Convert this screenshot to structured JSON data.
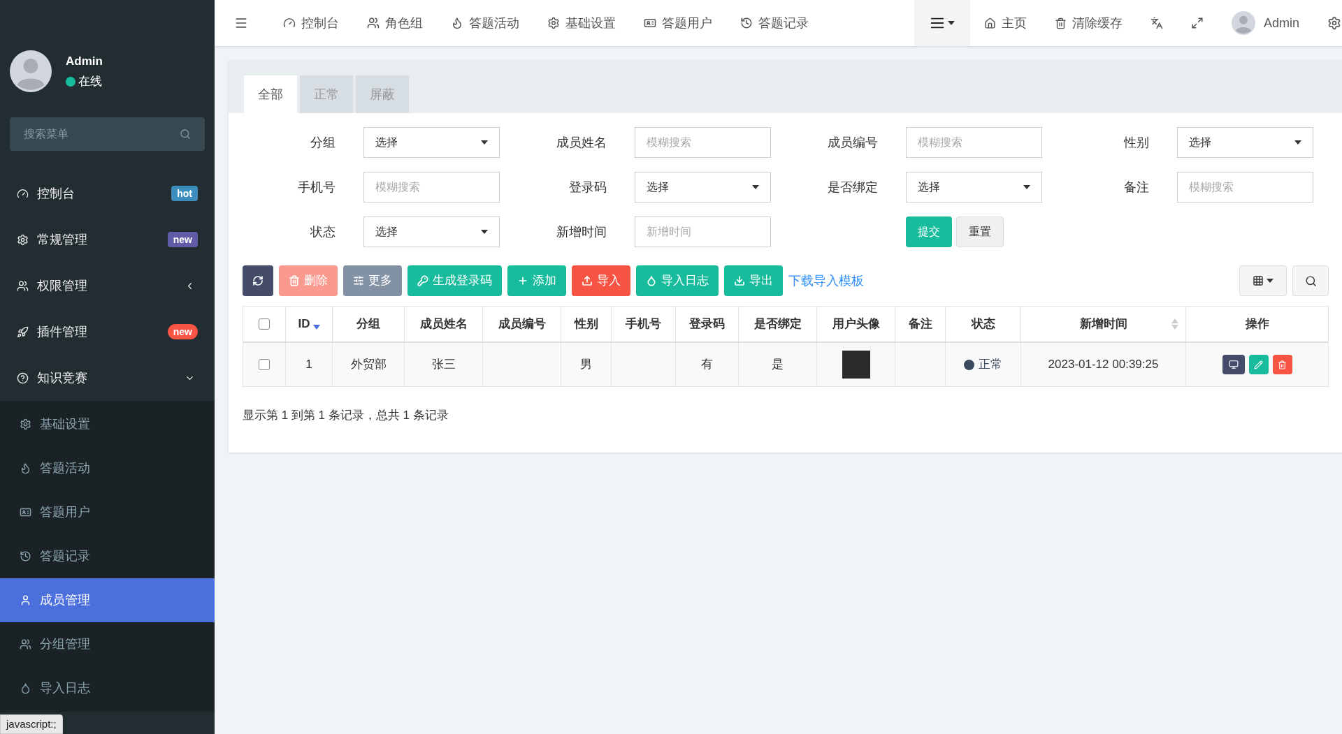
{
  "sidebar": {
    "user": {
      "name": "Admin",
      "status": "在线"
    },
    "search": {
      "placeholder": "搜索菜单"
    },
    "items": [
      {
        "label": "控制台",
        "badge": {
          "text": "hot",
          "color": "#3c8dbc"
        },
        "selected": false
      },
      {
        "label": "常规管理",
        "badge": {
          "text": "new",
          "color": "#605ca8"
        },
        "selected": false
      },
      {
        "label": "权限管理",
        "expanded": false,
        "selected": false
      },
      {
        "label": "插件管理",
        "badge": {
          "text": "new",
          "color": "#f75444"
        },
        "selected": false
      },
      {
        "label": "知识竞赛",
        "expanded": true,
        "selected": false,
        "children": [
          {
            "label": "基础设置",
            "selected": false
          },
          {
            "label": "答题活动",
            "selected": false
          },
          {
            "label": "答题用户",
            "selected": false
          },
          {
            "label": "答题记录",
            "selected": false
          },
          {
            "label": "成员管理",
            "selected": true
          },
          {
            "label": "分组管理",
            "selected": false
          },
          {
            "label": "导入日志",
            "selected": false
          }
        ]
      }
    ]
  },
  "status_tip": "javascript:;",
  "topbar": {
    "nav": [
      "控制台",
      "角色组",
      "答题活动",
      "基础设置",
      "答题用户",
      "答题记录"
    ],
    "home": "主页",
    "clear_cache": "清除缓存",
    "user": "Admin"
  },
  "tabs": [
    {
      "label": "全部",
      "selected": true
    },
    {
      "label": "正常",
      "selected": false
    },
    {
      "label": "屏蔽",
      "selected": false
    }
  ],
  "filters": [
    {
      "label": "分组",
      "kind": "select",
      "value": "选择"
    },
    {
      "label": "成员姓名",
      "kind": "text",
      "placeholder": "模糊搜索"
    },
    {
      "label": "成员编号",
      "kind": "text",
      "placeholder": "模糊搜索"
    },
    {
      "label": "性别",
      "kind": "select",
      "value": "选择"
    },
    {
      "label": "手机号",
      "kind": "text",
      "placeholder": "模糊搜索"
    },
    {
      "label": "登录码",
      "kind": "select",
      "value": "选择"
    },
    {
      "label": "是否绑定",
      "kind": "select",
      "value": "选择"
    },
    {
      "label": "备注",
      "kind": "text",
      "placeholder": "模糊搜索"
    },
    {
      "label": "状态",
      "kind": "select",
      "value": "选择"
    },
    {
      "label": "新增时间",
      "kind": "text",
      "placeholder": "新增时间"
    }
  ],
  "filter_buttons": [
    "提交",
    "重置"
  ],
  "toolbar": [
    {
      "kind": "refresh",
      "color": "#444c69"
    },
    {
      "kind": "delete",
      "label": "删除",
      "color": "#fa9a8f"
    },
    {
      "kind": "more",
      "label": "更多",
      "color": "#8391a5"
    },
    {
      "kind": "key",
      "label": "生成登录码",
      "color": "#18bc9c"
    },
    {
      "kind": "add",
      "label": "添加",
      "color": "#18bc9c"
    },
    {
      "kind": "upload",
      "label": "导入",
      "color": "#f75444"
    },
    {
      "kind": "drop",
      "label": "导入日志",
      "color": "#18bc9c"
    },
    {
      "kind": "download",
      "label": "导出",
      "color": "#18bc9c"
    }
  ],
  "template_link": "下载导入模板",
  "table": {
    "columns": [
      {
        "label": "ID",
        "sortable": true,
        "sorted_desc": true
      },
      {
        "label": "分组"
      },
      {
        "label": "成员姓名"
      },
      {
        "label": "成员编号"
      },
      {
        "label": "性别"
      },
      {
        "label": "手机号"
      },
      {
        "label": "登录码"
      },
      {
        "label": "是否绑定"
      },
      {
        "label": "用户头像"
      },
      {
        "label": "备注"
      },
      {
        "label": "状态"
      },
      {
        "label": "新增时间",
        "sortable": true,
        "sorted_desc": false
      },
      {
        "label": "操作"
      }
    ],
    "header_checked": false,
    "rows": [
      {
        "checked": false,
        "id": "1",
        "group": "外贸部",
        "name": "张三",
        "number": "",
        "gender": "男",
        "phone": "",
        "login_code": "有",
        "bound": "是",
        "remark": "",
        "status": {
          "text": "正常",
          "color": "#3c4a5e"
        },
        "created": "2023-01-12 00:39:25"
      }
    ]
  },
  "pagination_info": "显示第 1 到第 1 条记录，总共 1 条记录"
}
